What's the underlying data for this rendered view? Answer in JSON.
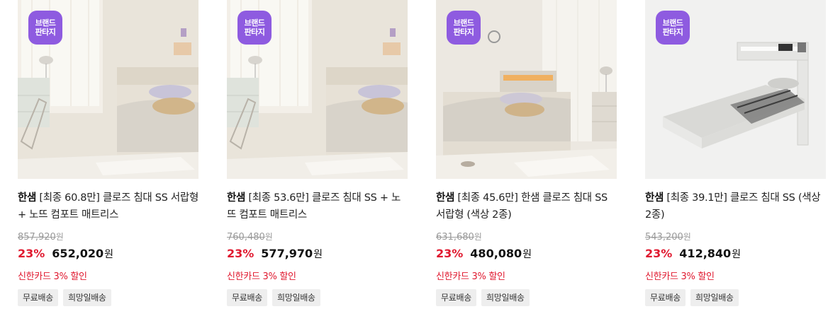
{
  "products": [
    {
      "badge_line1": "브랜드",
      "badge_line2": "판타지",
      "brand": "한샘",
      "title": "[최종 60.8만] 클로즈 침대 SS 서랍형 + 노뜨 컴포트 매트리스",
      "original_price": "857,920",
      "original_unit": "원",
      "discount_rate": "23%",
      "sale_price": "652,020",
      "sale_unit": "원",
      "card_promo": "신한카드 3% 할인",
      "tags": [
        "무료배송",
        "희망일배송"
      ]
    },
    {
      "badge_line1": "브랜드",
      "badge_line2": "판타지",
      "brand": "한샘",
      "title": "[최종 53.6만] 클로즈 침대 SS + 노뜨 컴포트 매트리스",
      "original_price": "760,480",
      "original_unit": "원",
      "discount_rate": "23%",
      "sale_price": "577,970",
      "sale_unit": "원",
      "card_promo": "신한카드 3% 할인",
      "tags": [
        "무료배송",
        "희망일배송"
      ]
    },
    {
      "badge_line1": "브랜드",
      "badge_line2": "판타지",
      "brand": "한샘",
      "title": "[최종 45.6만] 한샘 클로즈 침대 SS 서랍형 (색상 2종)",
      "original_price": "631,680",
      "original_unit": "원",
      "discount_rate": "23%",
      "sale_price": "480,080",
      "sale_unit": "원",
      "card_promo": "신한카드 3% 할인",
      "tags": [
        "무료배송",
        "희망일배송"
      ]
    },
    {
      "badge_line1": "브랜드",
      "badge_line2": "판타지",
      "brand": "한샘",
      "title": "[최종 39.1만] 클로즈 침대 SS (색상 2종)",
      "original_price": "543,200",
      "original_unit": "원",
      "discount_rate": "23%",
      "sale_price": "412,840",
      "sale_unit": "원",
      "card_promo": "신한카드 3% 할인",
      "tags": [
        "무료배송",
        "희망일배송"
      ]
    }
  ],
  "colors": {
    "badge": "#8e5be0",
    "discount": "#e0192f",
    "tag_bg": "#eeeeee"
  }
}
